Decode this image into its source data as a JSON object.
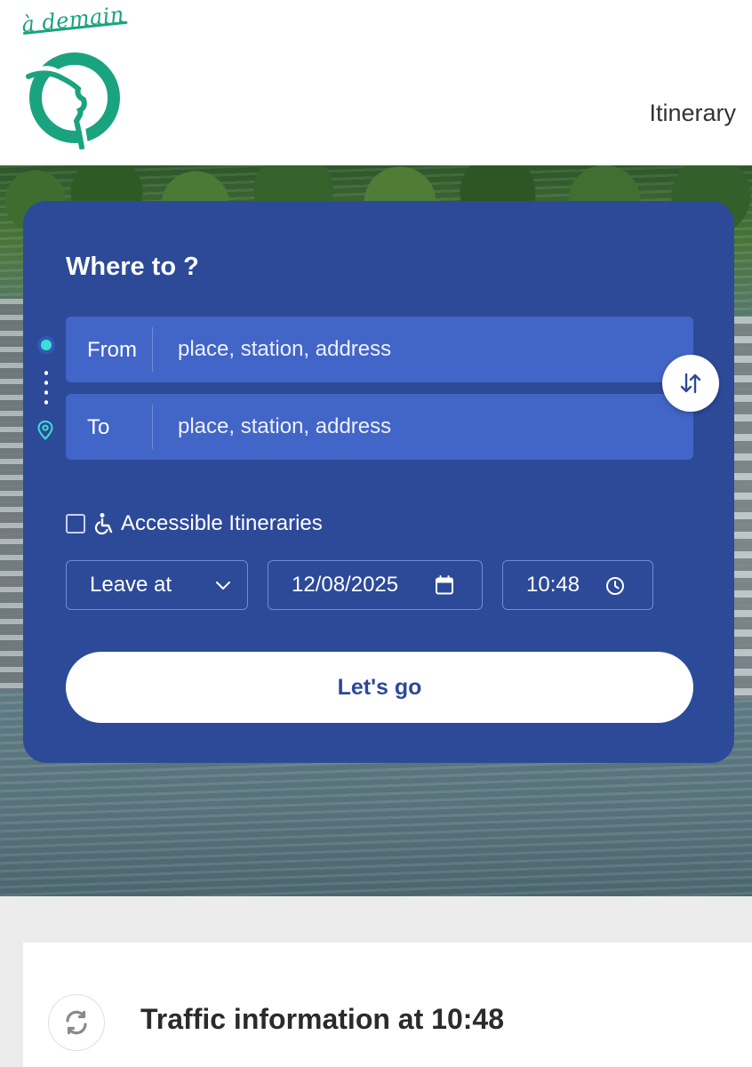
{
  "brand": {
    "tagline": "à demain",
    "logo_icon": "ratp-logo-icon",
    "color": "#1aa37f"
  },
  "header": {
    "nav_label": "Itinerary"
  },
  "search": {
    "title": "Where to ?",
    "from": {
      "label": "From",
      "placeholder": "place, station, address",
      "value": ""
    },
    "to": {
      "label": "To",
      "placeholder": "place, station, address",
      "value": ""
    },
    "swap_icon": "swap-vertical-icon",
    "accessible": {
      "label": "Accessible Itineraries",
      "checked": false,
      "icon": "wheelchair-icon"
    },
    "departure_mode": {
      "selected": "Leave at",
      "icon": "chevron-down-icon"
    },
    "date": {
      "value": "12/08/2025",
      "icon": "calendar-icon"
    },
    "time": {
      "value": "10:48",
      "icon": "clock-icon"
    },
    "submit_label": "Let's go",
    "card_color": "#2d4a99",
    "field_color": "#4265c8",
    "accent_color": "#3ce0d2"
  },
  "traffic": {
    "title": "Traffic information at 10:48",
    "refresh_icon": "refresh-icon"
  }
}
